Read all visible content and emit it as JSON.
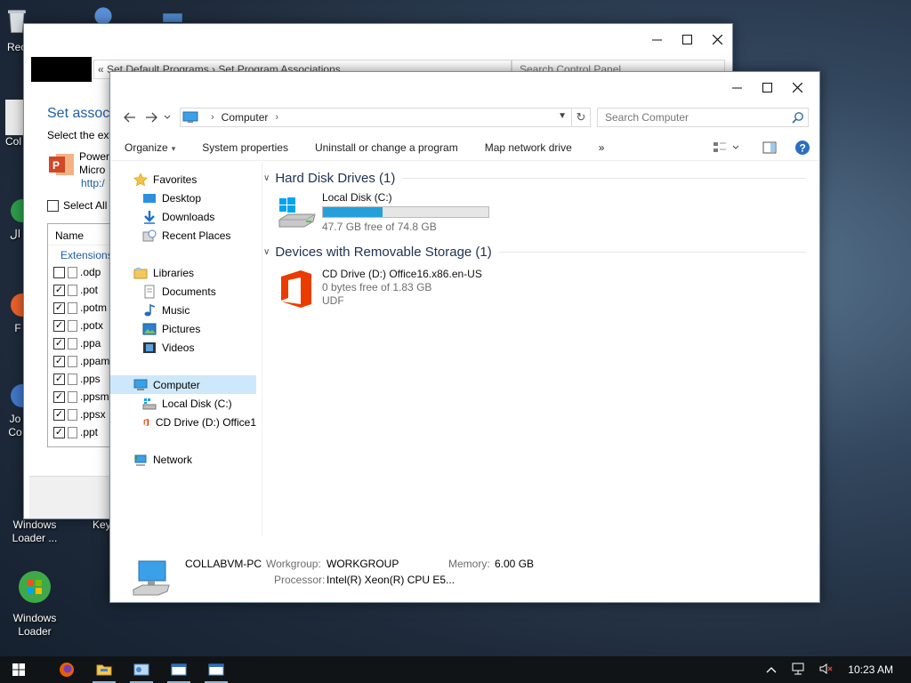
{
  "desktop": {
    "icons": [
      {
        "label": "Rec"
      },
      {
        "label": "Col"
      },
      {
        "label": "ال"
      },
      {
        "label": "F"
      },
      {
        "label": "Jo\nCo"
      },
      {
        "label": "Windows\nLoader ..."
      },
      {
        "label": "Key"
      },
      {
        "label": "Windows\nLoader"
      }
    ]
  },
  "back_window": {
    "address": "«  Set Default Programs  ›  Set Program Associations",
    "search_placeholder": "Search Control Panel",
    "title": "Set associ",
    "subtitle": "Select the ext",
    "app_name_line1": "Power",
    "app_name_line2": "Micro",
    "app_link": "http:/",
    "select_all": "Select All",
    "list_header": "Name",
    "list_group": "Extensions",
    "extensions": [
      {
        "name": ".odp",
        "checked": false
      },
      {
        "name": ".pot",
        "checked": true
      },
      {
        "name": ".potm",
        "checked": true
      },
      {
        "name": ".potx",
        "checked": true
      },
      {
        "name": ".ppa",
        "checked": true
      },
      {
        "name": ".ppam",
        "checked": true
      },
      {
        "name": ".pps",
        "checked": true
      },
      {
        "name": ".ppsm",
        "checked": true
      },
      {
        "name": ".ppsx",
        "checked": true
      },
      {
        "name": ".ppt",
        "checked": true
      }
    ]
  },
  "front_window": {
    "address_crumb": "Computer",
    "search_placeholder": "Search Computer",
    "toolbar": {
      "organize": "Organize",
      "system_properties": "System properties",
      "uninstall": "Uninstall or change a program",
      "map_drive": "Map network drive",
      "more": "»"
    },
    "nav": {
      "favorites": "Favorites",
      "desktop": "Desktop",
      "downloads": "Downloads",
      "recent": "Recent Places",
      "libraries": "Libraries",
      "documents": "Documents",
      "music": "Music",
      "pictures": "Pictures",
      "videos": "Videos",
      "computer": "Computer",
      "local_disk": "Local Disk (C:)",
      "cd_drive": "CD Drive (D:) Office1",
      "network": "Network"
    },
    "groups": {
      "hard_disks": "Hard Disk Drives (1)",
      "removable": "Devices with Removable Storage (1)"
    },
    "drives": {
      "c": {
        "name": "Local Disk (C:)",
        "free": "47.7 GB free of 74.8 GB",
        "used_fraction": 0.36
      },
      "d": {
        "name": "CD Drive (D:) Office16.x86.en-US",
        "free": "0 bytes free of 1.83 GB",
        "fs": "UDF"
      }
    },
    "details": {
      "pc_name": "COLLABVM-PC",
      "workgroup_label": "Workgroup:",
      "workgroup": "WORKGROUP",
      "memory_label": "Memory:",
      "memory": "6.00 GB",
      "processor_label": "Processor:",
      "processor": "Intel(R) Xeon(R) CPU E5..."
    }
  },
  "taskbar": {
    "clock": "10:23 AM"
  },
  "colors": {
    "accent": "#26a0da",
    "selection": "#cde8fb",
    "link": "#1f5fa6",
    "office_orange": "#eb3c00"
  }
}
